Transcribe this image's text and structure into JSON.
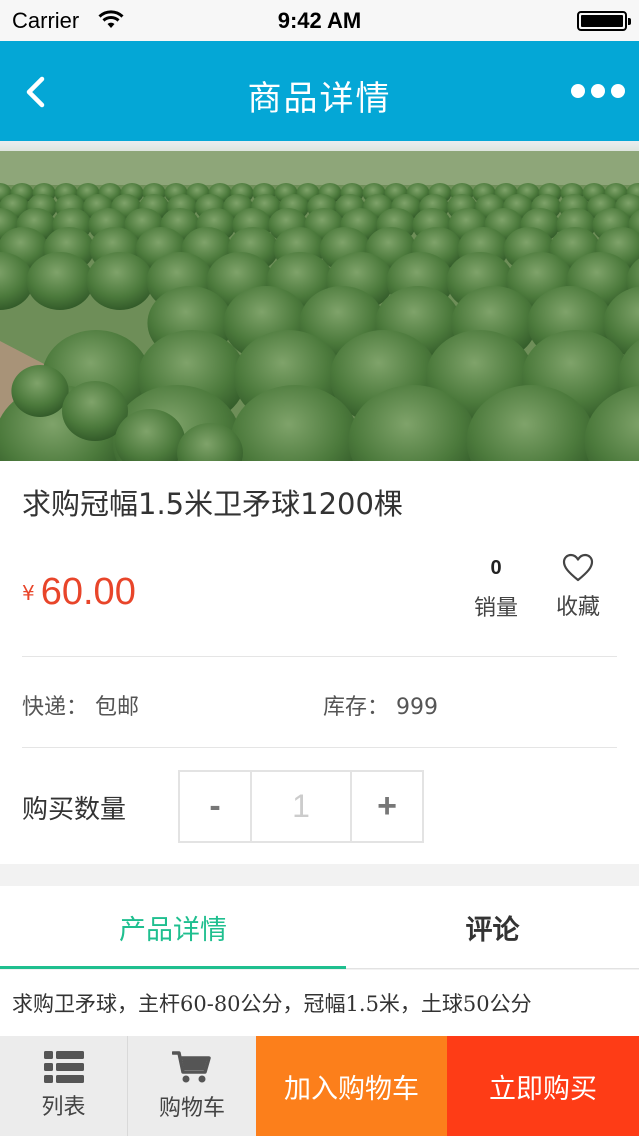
{
  "status_bar": {
    "carrier": "Carrier",
    "time": "9:42 AM"
  },
  "nav": {
    "title": "商品详情",
    "back_icon": "chevron-left-icon",
    "more_icon": "more-dots-icon"
  },
  "product": {
    "image_desc_icon": "product-photo",
    "title": "求购冠幅1.5米卫矛球1200棵",
    "price_symbol": "¥",
    "price": "60.00",
    "sales_count": "0",
    "sales_label": "销量",
    "favorite_label": "收藏",
    "shipping": "快递： 包邮",
    "stock": "库存： 999",
    "quantity_label": "购买数量",
    "quantity_minus": "-",
    "quantity_value": "1",
    "quantity_plus": "+"
  },
  "tabs": [
    {
      "label": "产品详情",
      "active": true
    },
    {
      "label": "评论",
      "active": false
    }
  ],
  "description": "求购卫矛球，主杆60-80公分，冠幅1.5米，土球50公分",
  "bottom_bar": {
    "list_label": "列表",
    "cart_label": "购物车",
    "add_to_cart": "加入购物车",
    "buy_now": "立即购买"
  },
  "colors": {
    "nav_bg": "#04a7d6",
    "price": "#e8452a",
    "tab_active": "#1fbf8f",
    "add_to_cart_bg": "#fc7f1b",
    "buy_now_bg": "#fe3c16"
  }
}
